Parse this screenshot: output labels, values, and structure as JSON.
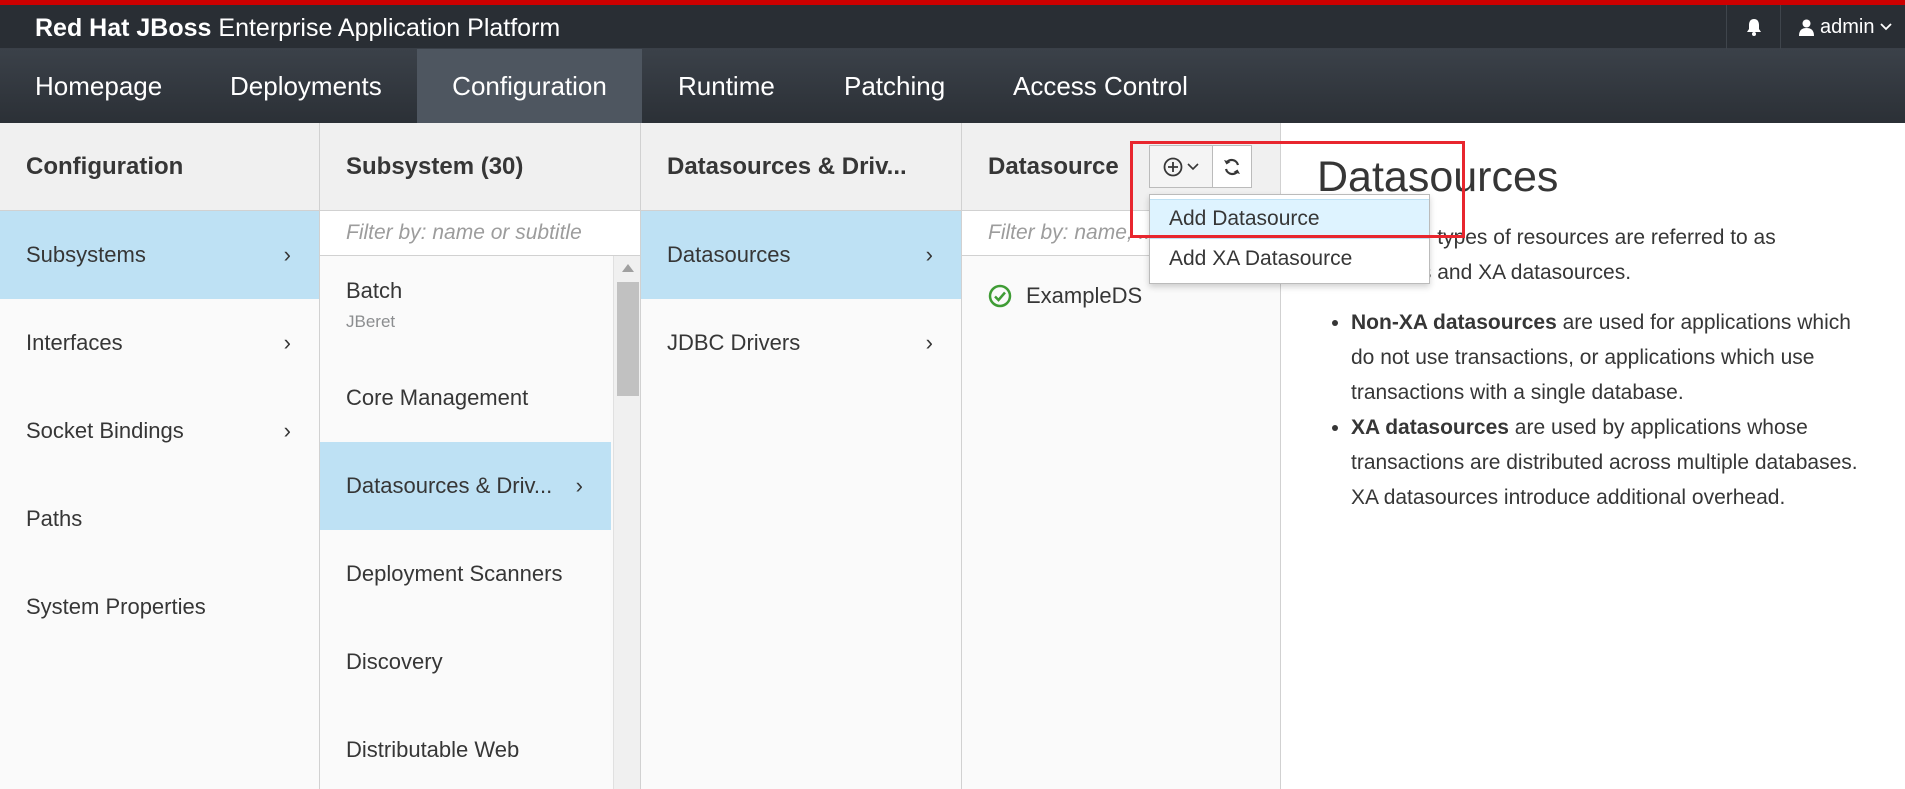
{
  "brand": {
    "bold": "Red Hat JBoss",
    "light": "Enterprise Application Platform"
  },
  "header": {
    "user_label": "admin"
  },
  "nav": {
    "items": [
      {
        "label": "Homepage"
      },
      {
        "label": "Deployments"
      },
      {
        "label": "Configuration"
      },
      {
        "label": "Runtime"
      },
      {
        "label": "Patching"
      },
      {
        "label": "Access Control"
      }
    ]
  },
  "col1": {
    "title": "Configuration",
    "items": [
      {
        "label": "Subsystems"
      },
      {
        "label": "Interfaces"
      },
      {
        "label": "Socket Bindings"
      },
      {
        "label": "Paths"
      },
      {
        "label": "System Properties"
      }
    ]
  },
  "col2": {
    "title": "Subsystem (30)",
    "filter_placeholder": "Filter by: name or subtitle",
    "items": [
      {
        "label": "Batch",
        "subtitle": "JBeret"
      },
      {
        "label": "Core Management"
      },
      {
        "label": "Datasources & Driv..."
      },
      {
        "label": "Deployment Scanners"
      },
      {
        "label": "Discovery"
      },
      {
        "label": "Distributable Web"
      }
    ]
  },
  "col3": {
    "title": "Datasources & Driv...",
    "items": [
      {
        "label": "Datasources"
      },
      {
        "label": "JDBC Drivers"
      }
    ]
  },
  "col4": {
    "title": "Datasource",
    "filter_placeholder": "Filter by: name, ...",
    "items": [
      {
        "label": "ExampleDS",
        "status": "ok"
      }
    ]
  },
  "dropdown": {
    "items": [
      {
        "label": "Add Datasource"
      },
      {
        "label": "Add XA Datasource"
      }
    ]
  },
  "description": {
    "title": "Datasources",
    "intro": "Two general types of resources are referred to as datasources and XA datasources.",
    "bullets": [
      {
        "bold": "Non-XA datasources",
        "text": " are used for applications which do not use transactions, or applications which use transactions with a single database."
      },
      {
        "bold": "XA datasources",
        "text": " are used by applications whose transactions are distributed across multiple databases. XA datasources introduce additional overhead."
      }
    ]
  },
  "colors": {
    "top_stripe": "#cc0000",
    "selected_row": "#bee1f4",
    "highlight_box": "#e8262e",
    "status_ok": "#3f9c35"
  }
}
